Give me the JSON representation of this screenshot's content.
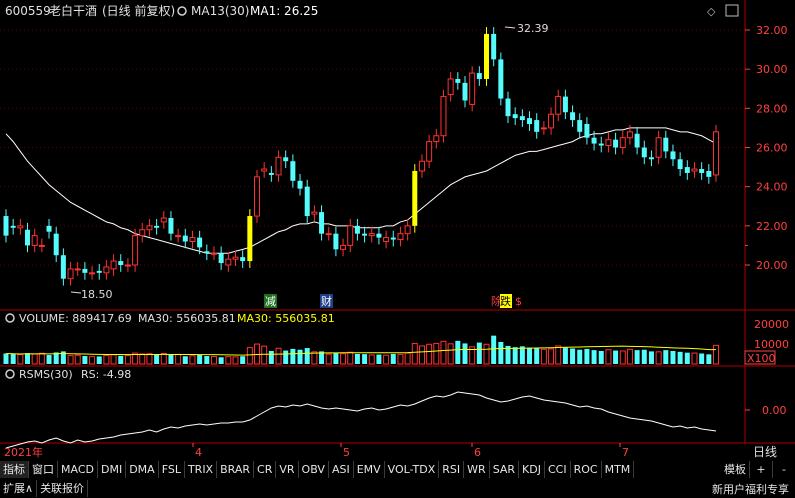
{
  "header": {
    "code": "600559",
    "name": "老白干酒",
    "period": "(日线 前复权)",
    "ma_label": "MA13(30)",
    "ma_value": "MA1: 26.25",
    "max_label": "32.39",
    "min_label": "18.50",
    "events": [
      "减",
      "财",
      "除",
      "跌",
      "$"
    ]
  },
  "price_axis": [
    "32.00",
    "30.00",
    "28.00",
    "26.00",
    "24.00",
    "22.00",
    "20.00"
  ],
  "volume": {
    "label": "VOLUME: 889417.69",
    "ma30_label": "MA30: 556035.81",
    "ma30_label2": "MA30: 556035.81",
    "axis": [
      "20000",
      "10000",
      "X100"
    ]
  },
  "rsms": {
    "label": "RSMS(30)",
    "value": "RS: -4.98",
    "axis": [
      "0.00"
    ]
  },
  "x_axis": {
    "labels": [
      "2021年",
      "4",
      "5",
      "6",
      "7"
    ],
    "period_button": "日线"
  },
  "tabs": [
    "指标",
    "窗口",
    "MACD",
    "DMI",
    "DMA",
    "FSL",
    "TRIX",
    "BRAR",
    "CR",
    "VR",
    "OBV",
    "ASI",
    "EMV",
    "VOL-TDX",
    "RSI",
    "WR",
    "SAR",
    "KDJ",
    "CCI",
    "ROC",
    "MTM"
  ],
  "tab_right": [
    "模板",
    "+",
    "-"
  ],
  "status": {
    "expand": "扩展∧",
    "news": "关联报价",
    "promo": "新用户福利专享"
  },
  "colors": {
    "up": "#ff3232",
    "down": "#54fcfc",
    "ma": "#ffffff",
    "highlight": "#ffff00",
    "grid": "#b00000"
  },
  "chart_data": {
    "type": "candlestick",
    "ylim": [
      18.5,
      33.0
    ],
    "x": [
      "2021-03-01",
      "2021-03-02",
      "2021-03-03",
      "2021-03-04",
      "2021-03-05",
      "2021-03-08",
      "2021-03-09",
      "2021-03-10",
      "2021-03-11",
      "2021-03-12",
      "2021-03-15",
      "2021-03-16",
      "2021-03-17",
      "2021-03-18",
      "2021-03-19",
      "2021-03-22",
      "2021-03-23",
      "2021-03-24",
      "2021-03-25",
      "2021-03-26",
      "2021-03-29",
      "2021-03-30",
      "2021-03-31",
      "2021-04-01",
      "2021-04-02",
      "2021-04-06",
      "2021-04-07",
      "2021-04-08",
      "2021-04-09",
      "2021-04-12",
      "2021-04-13",
      "2021-04-14",
      "2021-04-15",
      "2021-04-16",
      "2021-04-19",
      "2021-04-20",
      "2021-04-21",
      "2021-04-22",
      "2021-04-23",
      "2021-04-26",
      "2021-04-27",
      "2021-04-28",
      "2021-04-29",
      "2021-04-30",
      "2021-05-06",
      "2021-05-07",
      "2021-05-10",
      "2021-05-11",
      "2021-05-12",
      "2021-05-13",
      "2021-05-14",
      "2021-05-17",
      "2021-05-18",
      "2021-05-19",
      "2021-05-20",
      "2021-05-21",
      "2021-05-24",
      "2021-05-25",
      "2021-05-26",
      "2021-05-27",
      "2021-05-28",
      "2021-05-31",
      "2021-06-01",
      "2021-06-02",
      "2021-06-03",
      "2021-06-04",
      "2021-06-07",
      "2021-06-08",
      "2021-06-09",
      "2021-06-10",
      "2021-06-11",
      "2021-06-15",
      "2021-06-16",
      "2021-06-17",
      "2021-06-18",
      "2021-06-21",
      "2021-06-22",
      "2021-06-23",
      "2021-06-24",
      "2021-06-25",
      "2021-06-28",
      "2021-06-29",
      "2021-06-30",
      "2021-07-01",
      "2021-07-02",
      "2021-07-05",
      "2021-07-06",
      "2021-07-07",
      "2021-07-08",
      "2021-07-09",
      "2021-07-12",
      "2021-07-13",
      "2021-07-14",
      "2021-07-15",
      "2021-07-16",
      "2021-07-19",
      "2021-07-20",
      "2021-07-21",
      "2021-07-22",
      "2021-07-23"
    ],
    "open": [
      22.5,
      22.0,
      21.9,
      21.8,
      21.0,
      21.0,
      22.0,
      21.6,
      20.5,
      19.3,
      19.8,
      19.8,
      19.6,
      19.7,
      19.6,
      19.8,
      20.2,
      20.0,
      20.0,
      21.5,
      21.8,
      22.0,
      22.2,
      22.4,
      21.5,
      21.5,
      21.2,
      21.4,
      20.7,
      20.6,
      20.6,
      20.0,
      20.3,
      20.4,
      20.2,
      22.5,
      24.8,
      24.7,
      24.6,
      25.5,
      25.3,
      24.3,
      24.0,
      22.6,
      22.7,
      21.6,
      21.6,
      20.8,
      21.0,
      22.0,
      21.6,
      21.5,
      21.6,
      21.2,
      21.4,
      21.3,
      21.6,
      22.0,
      24.8,
      25.3,
      26.3,
      26.6,
      28.7,
      29.5,
      29.3,
      28.2,
      29.8,
      29.5,
      31.8,
      30.5,
      28.5,
      27.7,
      27.6,
      27.5,
      27.4,
      27.0,
      27.0,
      27.7,
      28.6,
      27.8,
      27.4,
      27.2,
      26.5,
      26.2,
      26.1,
      26.4,
      26.0,
      26.5,
      26.7,
      26.0,
      25.5,
      25.5,
      26.5,
      25.8,
      25.4,
      25.0,
      24.8,
      24.9,
      24.8,
      24.6
    ],
    "close": [
      21.5,
      21.9,
      22.0,
      21.0,
      21.5,
      21.0,
      21.7,
      20.5,
      19.3,
      19.8,
      19.8,
      19.6,
      19.6,
      19.6,
      19.9,
      20.2,
      20.0,
      20.0,
      21.5,
      21.8,
      22.0,
      21.9,
      22.4,
      21.6,
      21.5,
      21.2,
      21.4,
      20.9,
      20.6,
      20.6,
      20.1,
      20.3,
      20.4,
      20.2,
      22.5,
      24.5,
      24.9,
      24.6,
      25.5,
      25.3,
      24.3,
      23.9,
      22.5,
      22.7,
      21.6,
      21.6,
      20.8,
      21.0,
      22.0,
      21.6,
      21.5,
      21.6,
      21.4,
      21.4,
      21.3,
      21.6,
      22.0,
      24.8,
      25.3,
      26.3,
      26.6,
      28.6,
      29.5,
      29.3,
      28.4,
      29.8,
      29.5,
      31.8,
      30.5,
      28.5,
      27.6,
      27.5,
      27.4,
      27.2,
      26.8,
      27.0,
      27.7,
      28.6,
      27.8,
      27.4,
      26.8,
      26.5,
      26.2,
      26.1,
      26.4,
      26.0,
      26.5,
      26.8,
      26.0,
      25.5,
      25.4,
      26.5,
      25.8,
      25.4,
      24.9,
      24.7,
      24.9,
      24.7,
      24.5,
      26.8
    ],
    "ma30": [
      26.7,
      26.3,
      25.8,
      25.3,
      24.9,
      24.5,
      24.1,
      23.8,
      23.5,
      23.2,
      23.0,
      22.8,
      22.6,
      22.4,
      22.2,
      22.1,
      21.9,
      21.8,
      21.6,
      21.5,
      21.4,
      21.3,
      21.2,
      21.1,
      21.0,
      20.9,
      20.8,
      20.7,
      20.6,
      20.6,
      20.6,
      20.6,
      20.7,
      20.8,
      20.9,
      21.1,
      21.3,
      21.5,
      21.7,
      21.8,
      22.0,
      22.1,
      22.1,
      22.2,
      22.1,
      22.1,
      22.0,
      22.0,
      22.0,
      21.9,
      21.9,
      21.9,
      21.9,
      22.0,
      22.0,
      22.2,
      22.3,
      22.6,
      22.9,
      23.2,
      23.5,
      23.8,
      24.1,
      24.3,
      24.5,
      24.6,
      24.7,
      24.8,
      25.0,
      25.2,
      25.4,
      25.6,
      25.7,
      25.8,
      25.8,
      25.9,
      26.0,
      26.1,
      26.2,
      26.3,
      26.5,
      26.6,
      26.7,
      26.7,
      26.8,
      26.9,
      26.9,
      27.0,
      27.0,
      27.0,
      27.0,
      27.0,
      27.0,
      26.9,
      26.8,
      26.8,
      26.7,
      26.6,
      26.4,
      26.2
    ],
    "volume": [
      5000,
      4800,
      4500,
      5200,
      4700,
      5100,
      4300,
      5500,
      6000,
      4000,
      4200,
      3800,
      3500,
      3600,
      4100,
      4400,
      3900,
      4000,
      5200,
      4800,
      4900,
      4300,
      5000,
      4400,
      4600,
      3700,
      3900,
      4300,
      3800,
      3600,
      3200,
      3500,
      3400,
      3700,
      7800,
      9500,
      8500,
      6200,
      7500,
      6400,
      7200,
      6800,
      7600,
      5800,
      6000,
      4700,
      5200,
      4900,
      5600,
      4800,
      4700,
      4300,
      4500,
      4200,
      4800,
      4600,
      5200,
      9800,
      8600,
      9400,
      9800,
      10800,
      9600,
      11000,
      9800,
      8200,
      10200,
      9400,
      13500,
      10500,
      8600,
      8000,
      8400,
      7800,
      7600,
      7000,
      7200,
      8600,
      7800,
      7400,
      6800,
      7200,
      6600,
      6200,
      6800,
      6400,
      6200,
      7000,
      6600,
      6800,
      6000,
      5800,
      6600,
      6200,
      5800,
      5400,
      5200,
      5000,
      4600,
      8900
    ],
    "rs": [
      -38,
      -36,
      -34,
      -32,
      -31,
      -33,
      -30,
      -28,
      -31,
      -33,
      -30,
      -32,
      -31,
      -29,
      -28,
      -27,
      -25,
      -24,
      -23,
      -22,
      -20,
      -22,
      -19,
      -17,
      -18,
      -16,
      -15,
      -14,
      -15,
      -14,
      -13,
      -13,
      -12,
      -12,
      -10,
      -6,
      -2,
      2,
      4,
      3,
      5,
      4,
      6,
      4,
      2,
      1,
      2,
      1,
      0,
      -1,
      1,
      2,
      0,
      1,
      3,
      5,
      4,
      6,
      9,
      12,
      14,
      13,
      15,
      18,
      17,
      16,
      15,
      12,
      10,
      8,
      9,
      11,
      13,
      14,
      12,
      10,
      9,
      8,
      7,
      5,
      3,
      4,
      2,
      1,
      -2,
      -4,
      -6,
      -8,
      -9,
      -10,
      -11,
      -13,
      -15,
      -17,
      -16,
      -18,
      -17,
      -19,
      -20,
      -21
    ]
  }
}
